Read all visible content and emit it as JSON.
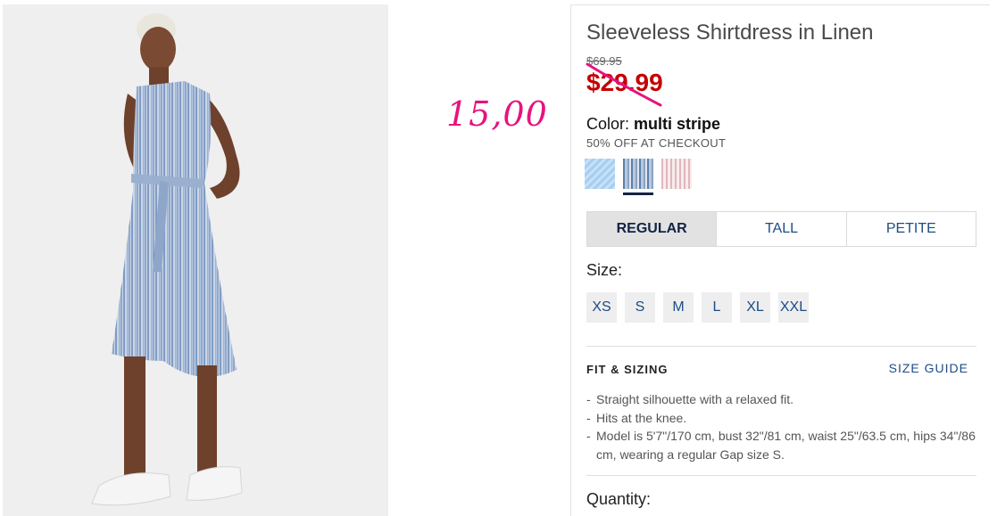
{
  "annotation": {
    "handwritten_price": "15,00"
  },
  "product": {
    "title": "Sleeveless Shirtdress in Linen",
    "original_price": "$69.95",
    "sale_price": "$29.99"
  },
  "color": {
    "label": "Color:",
    "value": "multi stripe",
    "promo": "50% OFF AT CHECKOUT",
    "swatches": [
      "light-blue",
      "multi-stripe",
      "pink-stripe"
    ],
    "selected_index": 1
  },
  "fits": {
    "tabs": [
      "REGULAR",
      "TALL",
      "PETITE"
    ],
    "active_index": 0
  },
  "sizes": {
    "label": "Size:",
    "options": [
      "XS",
      "S",
      "M",
      "L",
      "XL",
      "XXL"
    ]
  },
  "fit_sizing": {
    "heading": "FIT & SIZING",
    "guide_link": "SIZE GUIDE",
    "bullets": [
      "Straight silhouette with a relaxed fit.",
      "Hits at the knee.",
      "Model is 5'7\"/170 cm, bust 32\"/81 cm, waist 25\"/63.5 cm, hips 34\"/86 cm, wearing a regular Gap size S."
    ]
  },
  "quantity": {
    "label": "Quantity:"
  },
  "colors": {
    "sale_red": "#c40000",
    "link_blue": "#1c4c85",
    "annotation_pink": "#e6137e",
    "navy": "#122344"
  }
}
